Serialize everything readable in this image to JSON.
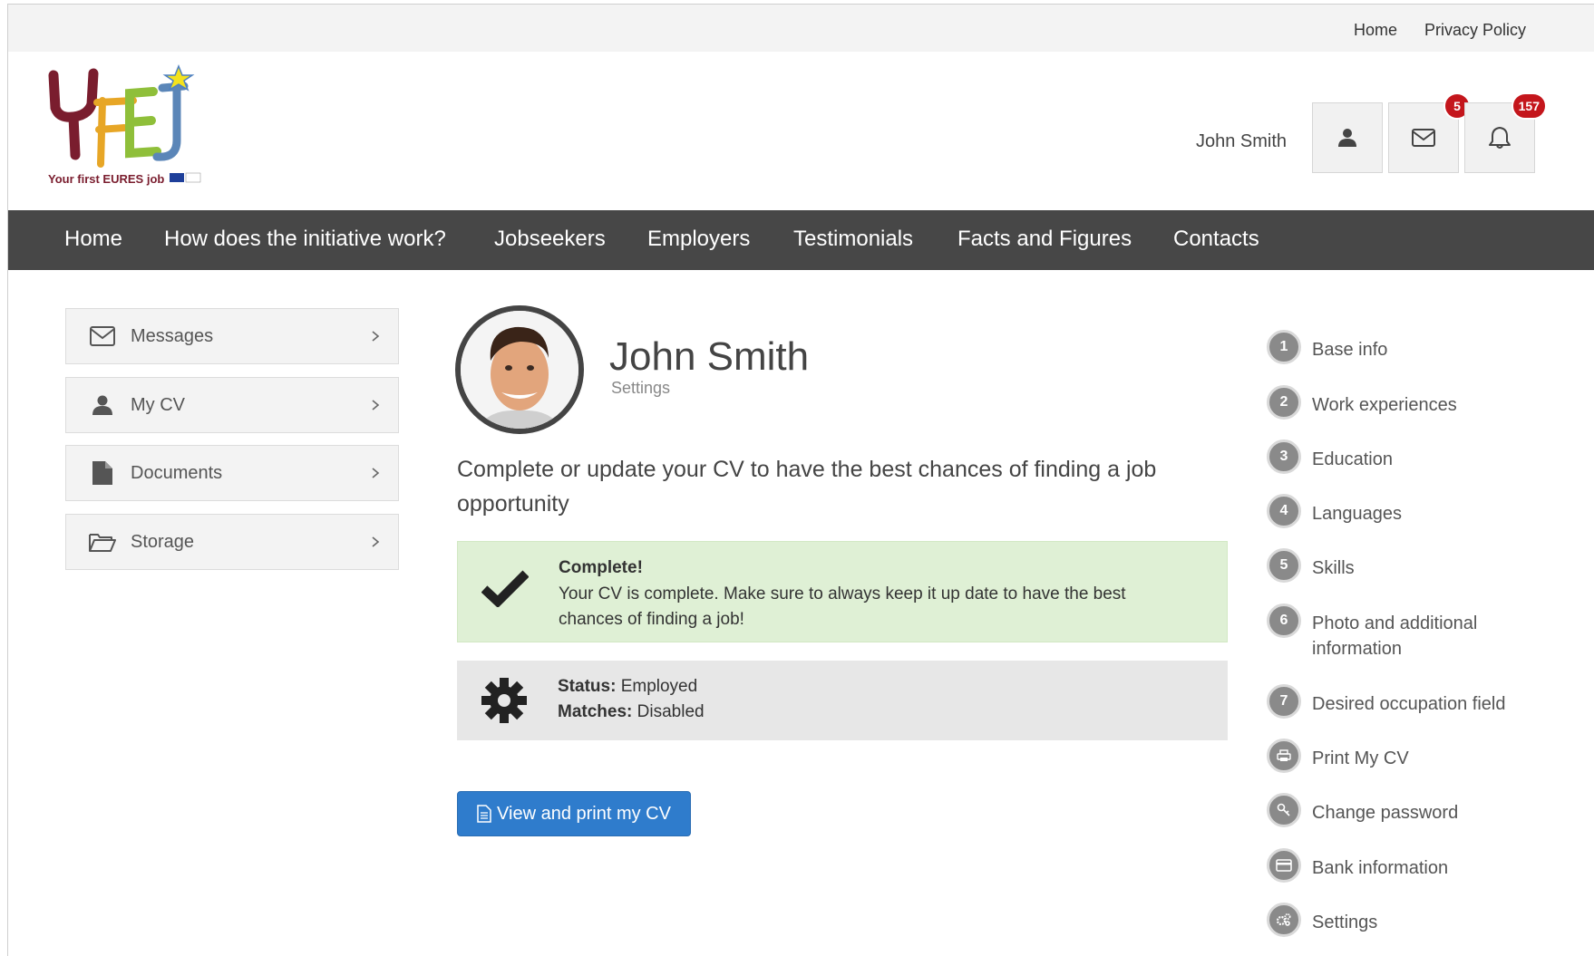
{
  "topbar": {
    "home": "Home",
    "privacy": "Privacy Policy"
  },
  "logo": {
    "tagline": "Your first EURES job"
  },
  "header": {
    "user_name": "John Smith",
    "messages_count": "5",
    "notifications_count": "157"
  },
  "nav": [
    "Home",
    "How does the initiative work?",
    "Jobseekers",
    "Employers",
    "Testimonials",
    "Facts and Figures",
    "Contacts"
  ],
  "sidebar": [
    {
      "label": "Messages",
      "icon": "envelope-icon"
    },
    {
      "label": "My CV",
      "icon": "user-icon"
    },
    {
      "label": "Documents",
      "icon": "document-icon"
    },
    {
      "label": "Storage",
      "icon": "folder-icon"
    }
  ],
  "profile": {
    "name": "John Smith",
    "subtitle": "Settings",
    "intro": "Complete or update your CV to have the best chances of finding a job opportunity"
  },
  "alert": {
    "title": "Complete!",
    "text": "Your CV is complete. Make sure to always keep it up date to have the best chances of finding a job!",
    "color": "#dff0d5"
  },
  "status": {
    "status_label": "Status:",
    "status_value": "Employed",
    "matches_label": "Matches:",
    "matches_value": "Disabled"
  },
  "print_button": "View and print my CV",
  "steps": [
    {
      "marker": "1",
      "label": "Base info"
    },
    {
      "marker": "2",
      "label": "Work experiences"
    },
    {
      "marker": "3",
      "label": "Education"
    },
    {
      "marker": "4",
      "label": "Languages"
    },
    {
      "marker": "5",
      "label": "Skills"
    },
    {
      "marker": "6",
      "label": "Photo and additional information"
    },
    {
      "marker": "7",
      "label": "Desired occupation field"
    },
    {
      "marker": "printer-icon",
      "label": "Print My CV"
    },
    {
      "marker": "key-icon",
      "label": "Change password"
    },
    {
      "marker": "card-icon",
      "label": "Bank information"
    },
    {
      "marker": "gears-icon",
      "label": "Settings"
    }
  ],
  "colors": {
    "nav_bg": "#474747",
    "primary": "#2f7ccc",
    "badge": "#c4161c",
    "step_circle": "#8a8a8a"
  }
}
